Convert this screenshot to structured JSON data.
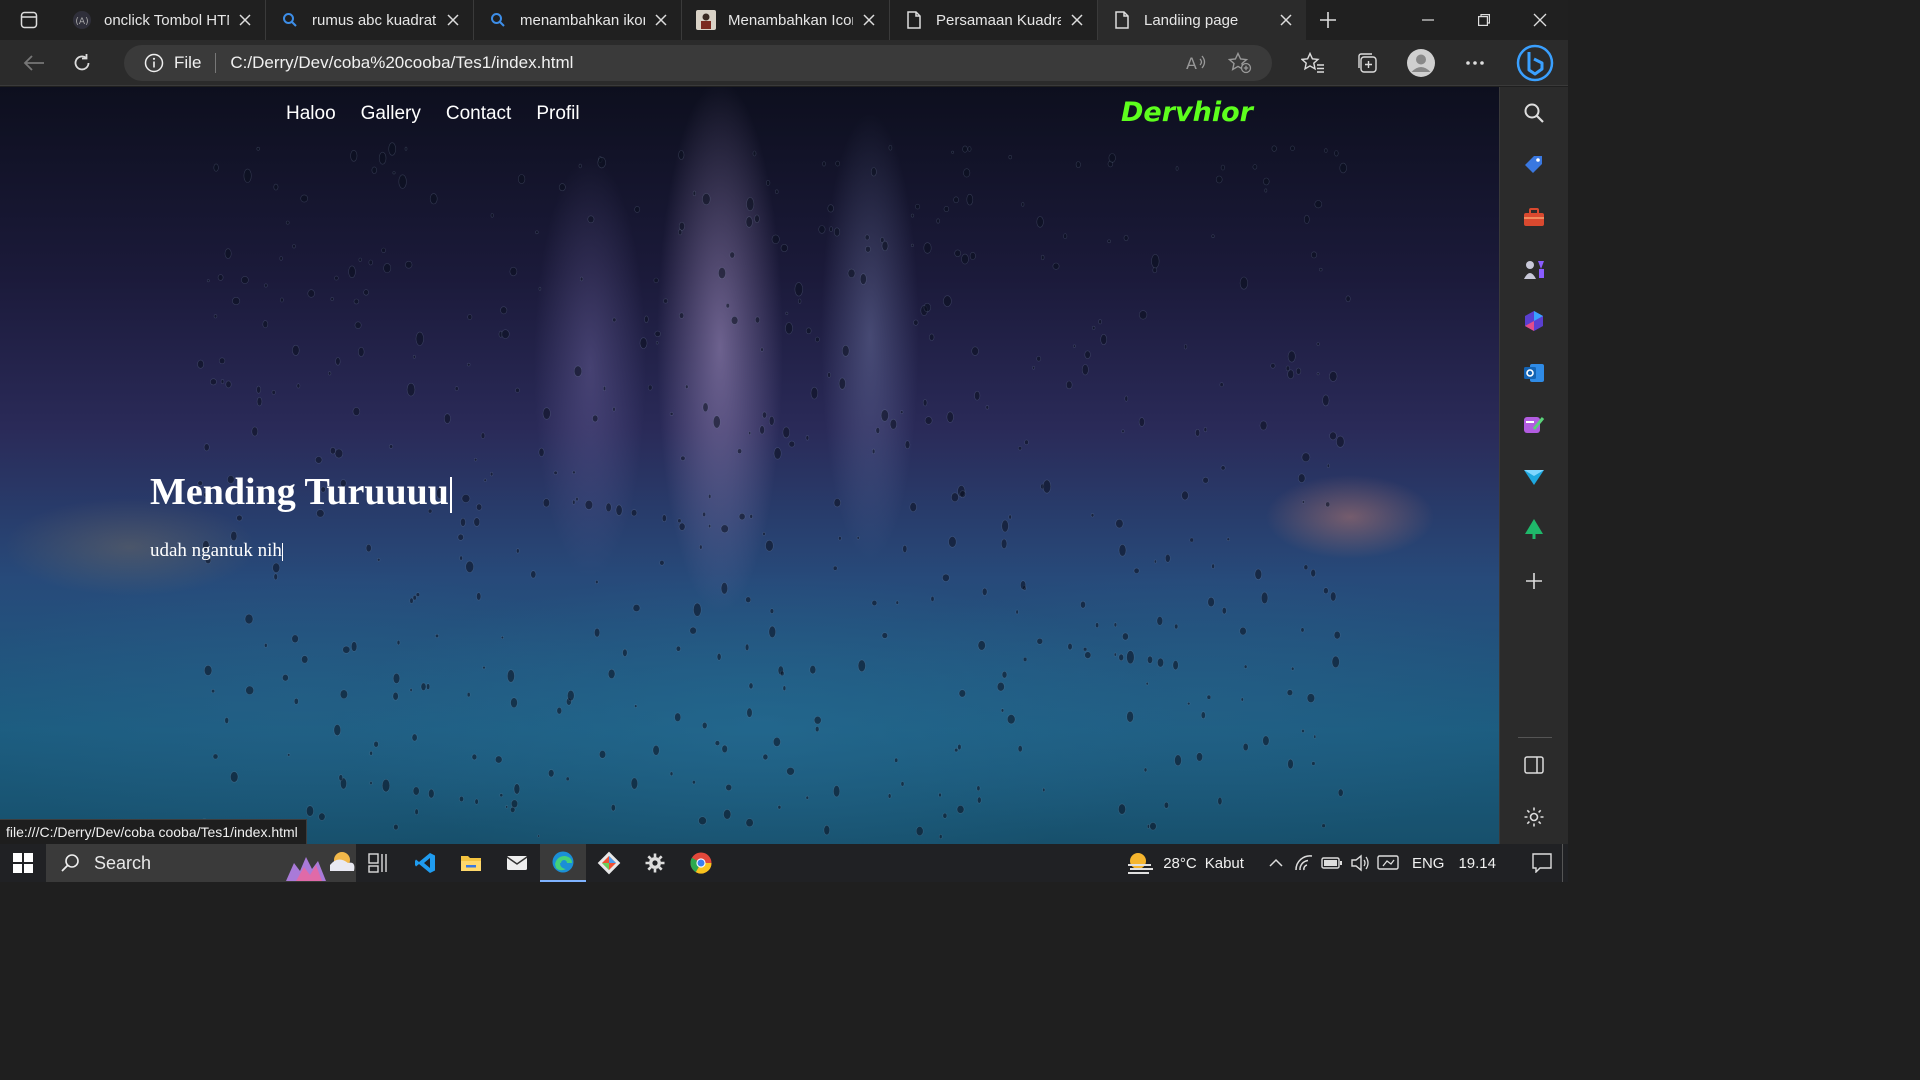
{
  "browser": {
    "tabs": [
      {
        "label": "onclick Tombol HTM",
        "favicon": "code-favicon"
      },
      {
        "label": "rumus abc kuadrat",
        "favicon": "search-icon"
      },
      {
        "label": "menambahkan ikon",
        "favicon": "search-icon"
      },
      {
        "label": "Menambahkan Icon",
        "favicon": "image-favicon"
      },
      {
        "label": "Persamaan Kuadrat",
        "favicon": "document-icon"
      },
      {
        "label": "Landiing page",
        "favicon": "document-icon",
        "active": true
      }
    ],
    "address": {
      "scheme_label": "File",
      "url": "C:/Derry/Dev/coba%20cooba/Tes1/index.html"
    },
    "status_url": "file:///C:/Derry/Dev/coba cooba/Tes1/index.html"
  },
  "page": {
    "nav": [
      "Haloo",
      "Gallery",
      "Contact",
      "Profil"
    ],
    "logo": "Dervhior",
    "hero_title": "Mending Turuuuu",
    "hero_subtitle": "udah ngantuk nih",
    "colors": {
      "logo": "#5dff1d",
      "text": "#ffffff"
    }
  },
  "sidebar": {
    "items": [
      "search-icon",
      "tag-icon",
      "toolbox-icon",
      "games-icon",
      "microsoft365-icon",
      "outlook-icon",
      "designer-icon",
      "send-icon",
      "tree-icon",
      "add-icon",
      "split-screen-icon",
      "settings-icon"
    ]
  },
  "taskbar": {
    "search_label": "Search",
    "apps": [
      "task-view-icon",
      "vscode-icon",
      "file-explorer-icon",
      "mail-icon",
      "edge-icon",
      "git-icon",
      "settings-icon",
      "chrome-icon"
    ],
    "weather": {
      "temp": "28°C",
      "condition": "Kabut"
    },
    "language": "ENG",
    "time": "19.14"
  }
}
